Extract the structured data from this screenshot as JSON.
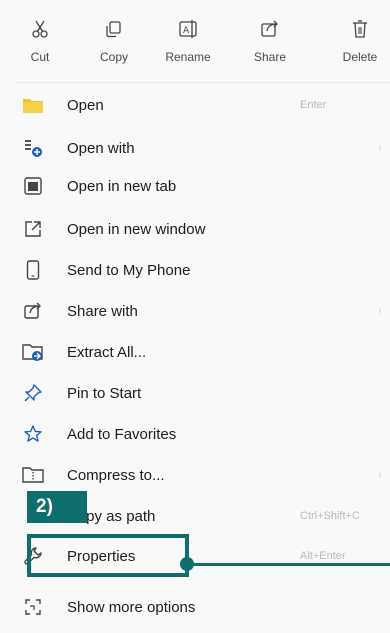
{
  "toolbar": {
    "cut": "Cut",
    "copy": "Copy",
    "rename": "Rename",
    "share": "Share",
    "delete": "Delete"
  },
  "menu": {
    "open": {
      "label": "Open",
      "shortcut": "Enter"
    },
    "open_with": {
      "label": "Open with"
    },
    "open_new_tab": {
      "label": "Open in new tab"
    },
    "open_new_window": {
      "label": "Open in new window"
    },
    "send_phone": {
      "label": "Send to My Phone"
    },
    "share_with": {
      "label": "Share with"
    },
    "extract_all": {
      "label": "Extract All..."
    },
    "pin_start": {
      "label": "Pin to Start"
    },
    "add_favorites": {
      "label": "Add to Favorites"
    },
    "compress": {
      "label": "Compress to..."
    },
    "copy_path": {
      "label": "Copy as path",
      "shortcut": "Ctrl+Shift+C"
    },
    "properties": {
      "label": "Properties",
      "shortcut": "Alt+Enter"
    },
    "show_more": {
      "label": "Show more options"
    }
  },
  "annotation": {
    "step": "2)"
  },
  "colors": {
    "accent": "#0f6f6f",
    "folder": "#f2c12e",
    "icon_blue": "#1a5fb4"
  }
}
